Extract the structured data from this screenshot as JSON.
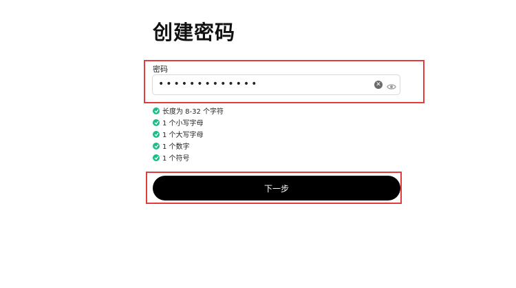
{
  "page": {
    "title": "创建密码"
  },
  "password_field": {
    "label": "密码",
    "value": "•••••••••••••"
  },
  "icons": {
    "clear": "clear-icon",
    "visibility": "eye-icon",
    "check": "check-circle-icon"
  },
  "requirements": [
    {
      "text": "长度为 8-32 个字符",
      "met": true
    },
    {
      "text": "1 个小写字母",
      "met": true
    },
    {
      "text": "1 个大写字母",
      "met": true
    },
    {
      "text": "1 个数字",
      "met": true
    },
    {
      "text": "1 个符号",
      "met": true
    }
  ],
  "next_button": {
    "label": "下一步"
  },
  "colors": {
    "check": "#1dbb87",
    "highlight": "#e23b3b",
    "button": "#000000"
  }
}
